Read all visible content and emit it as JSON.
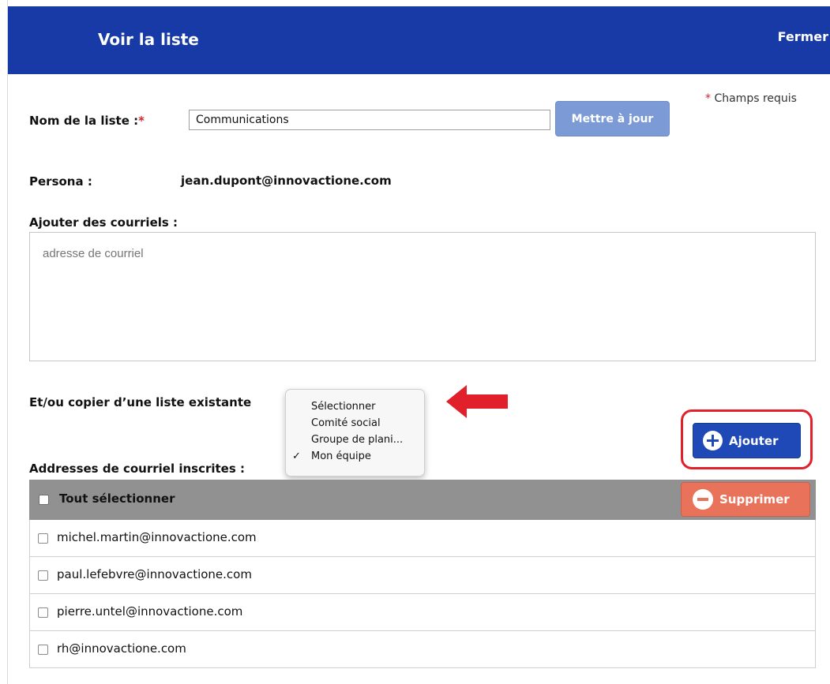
{
  "header": {
    "title": "Voir la liste",
    "close_label": "Fermer"
  },
  "form": {
    "required_star": "*",
    "required_note": "Champs requis",
    "list_name_label": "Nom de la liste :",
    "list_name_value": "Communications",
    "update_button": "Mettre à jour",
    "persona_label": "Persona :",
    "persona_value": "jean.dupont@innovactione.com",
    "add_emails_label": "Ajouter des courriels :",
    "add_emails_placeholder": "adresse de courriel",
    "copy_list_label": "Et/ou copier d’une liste existante",
    "add_button": "Ajouter",
    "subscribed_label": "Addresses de courriel inscrites :"
  },
  "dropdown": {
    "options": [
      {
        "label": "Sélectionner",
        "checked": false
      },
      {
        "label": "Comité social",
        "checked": false
      },
      {
        "label": "Groupe de plani...",
        "checked": false
      },
      {
        "label": "Mon équipe",
        "checked": true
      }
    ],
    "check_glyph": "✓"
  },
  "table": {
    "select_all_label": "Tout sélectionner",
    "delete_button": "Supprimer",
    "rows": [
      "michel.martin@innovactione.com",
      "paul.lefebvre@innovactione.com",
      "pierre.untel@innovactione.com",
      "rh@innovactione.com"
    ]
  },
  "colors": {
    "header_bg": "#173aa6",
    "add_button_bg": "#1f49b6",
    "delete_button_bg": "#e8735a",
    "highlight_red": "#e0202a",
    "arrow_red": "#e0202a"
  }
}
